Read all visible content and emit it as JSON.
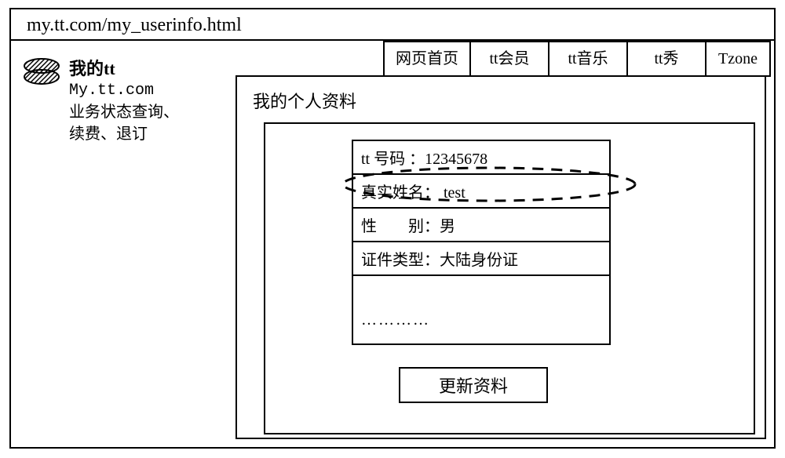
{
  "url": "my.tt.com/my_userinfo.html",
  "sidebar": {
    "brand_title": "我的tt",
    "brand_sub": "My.tt.com",
    "brand_desc_line1": "业务状态查询、",
    "brand_desc_line2": "续费、退订"
  },
  "tabs": [
    {
      "label": "网页首页"
    },
    {
      "label": "tt会员"
    },
    {
      "label": "tt音乐"
    },
    {
      "label": "tt秀"
    },
    {
      "label": "Tzone"
    }
  ],
  "panel": {
    "title": "我的个人资料",
    "rows": [
      {
        "text": "tt 号码 ：12345678"
      },
      {
        "text": "真实姓名： test"
      },
      {
        "text": "性　　别：男"
      },
      {
        "text": "证件类型：大陆身份证"
      },
      {
        "text": "…………"
      }
    ],
    "update_label": "更新资料"
  }
}
